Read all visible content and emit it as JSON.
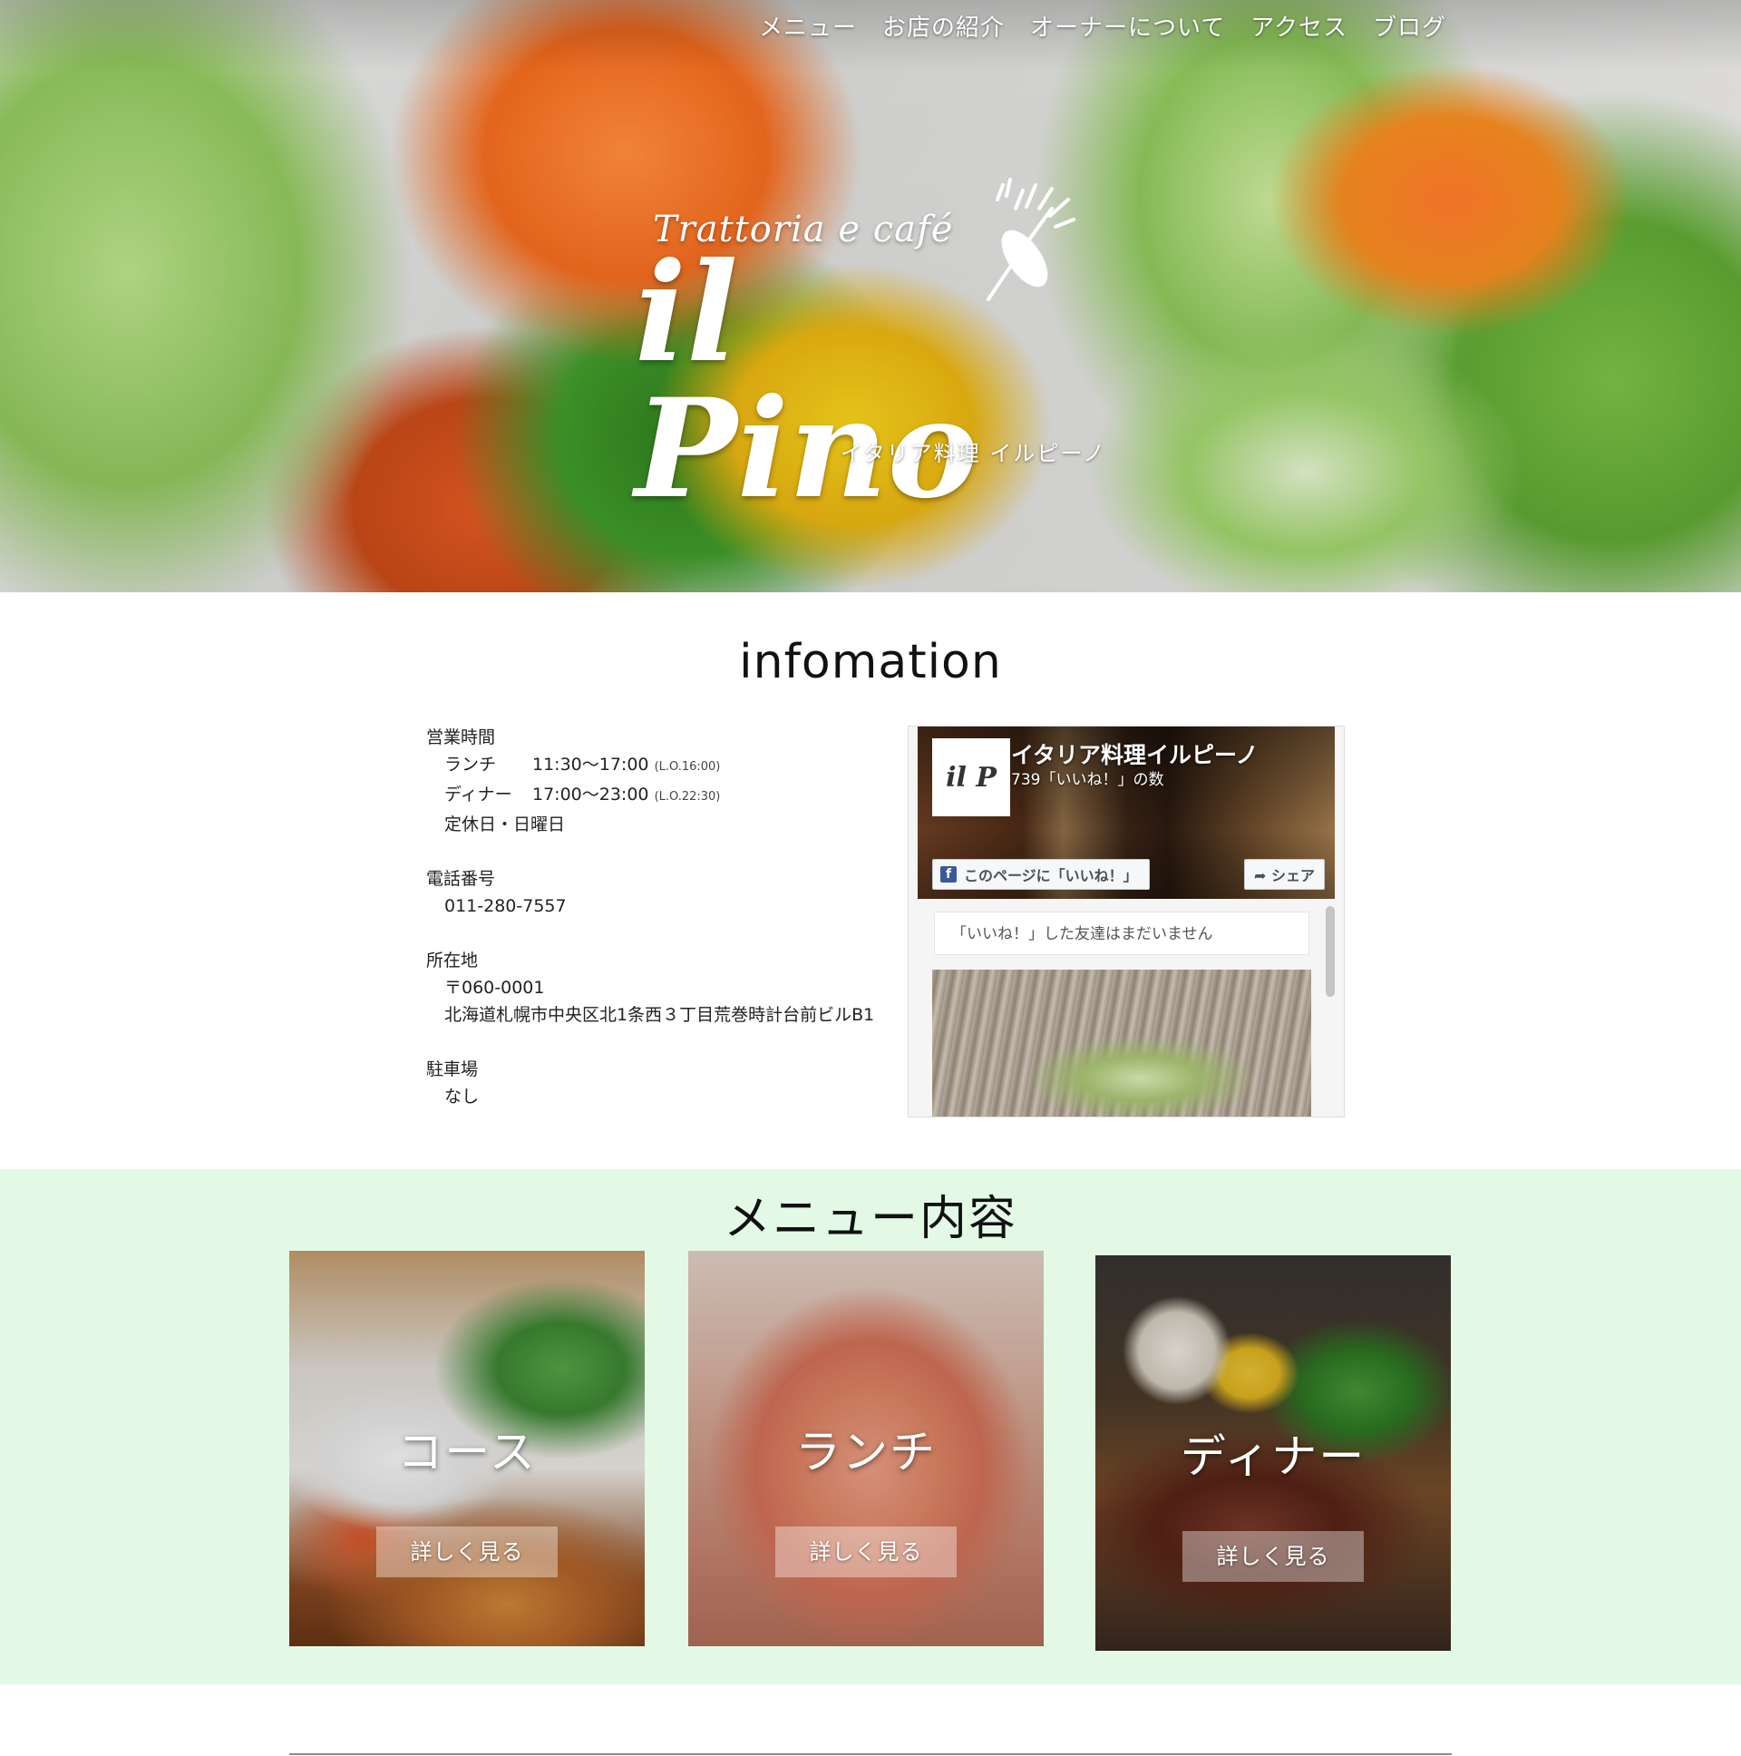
{
  "nav": {
    "items": [
      {
        "label": "メニュー"
      },
      {
        "label": "お店の紹介"
      },
      {
        "label": "オーナーについて"
      },
      {
        "label": "アクセス"
      },
      {
        "label": "ブログ"
      }
    ]
  },
  "hero": {
    "logo_sub": "Trattoria e café",
    "logo_main": "il Pino",
    "logo_kana": "イタリア料理 イルピーノ"
  },
  "info": {
    "title": "infomation",
    "hours": {
      "head": "営業時間",
      "lunch_label": "ランチ",
      "lunch_time": "11:30〜17:00",
      "lunch_lo": "(L.O.16:00)",
      "dinner_label": "ディナー",
      "dinner_time": "17:00〜23:00",
      "dinner_lo": "(L.O.22:30)",
      "closed": "定休日・日曜日"
    },
    "phone": {
      "head": "電話番号",
      "value": "011-280-7557"
    },
    "address": {
      "head": "所在地",
      "zip": "〒060-0001",
      "street": "北海道札幌市中央区北1条西３丁目荒巻時計台前ビルB1"
    },
    "parking": {
      "head": "駐車場",
      "value": "なし"
    }
  },
  "facebook": {
    "page_name": "イタリア料理イルピーノ",
    "likes": "739「いいね！」の数",
    "like_button": "このページに「いいね！」",
    "share_button": "シェア",
    "friends_text": "「いいね！」した友達はまだいません",
    "avatar_text": "il P"
  },
  "menu": {
    "title": "メニュー内容",
    "cards": [
      {
        "label": "コース",
        "button": "詳しく見る"
      },
      {
        "label": "ランチ",
        "button": "詳しく見る"
      },
      {
        "label": "ディナー",
        "button": "詳しく見る"
      }
    ]
  },
  "colors": {
    "menu_background": "#e3f9e6",
    "facebook_blue": "#3b5998"
  }
}
